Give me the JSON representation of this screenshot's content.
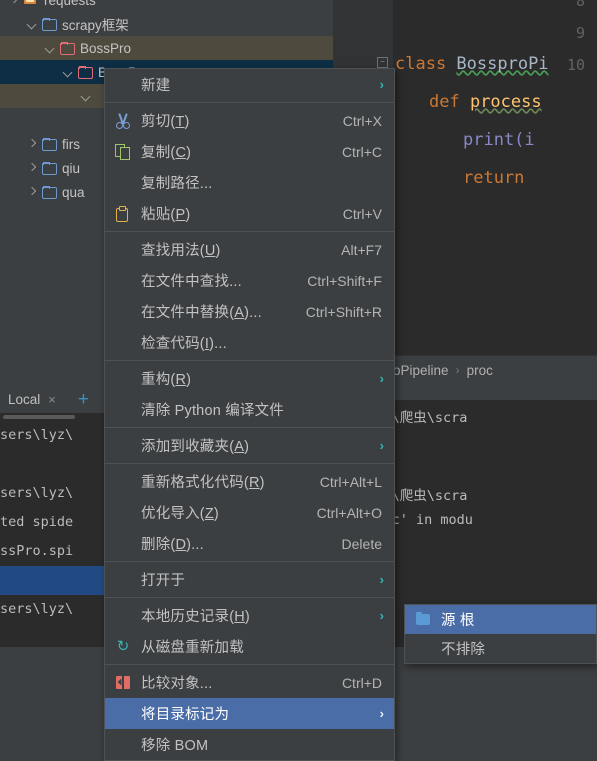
{
  "project_tree": {
    "rows": [
      {
        "label": "requests",
        "icon": "library-icon",
        "chevron": "right",
        "indent": 8,
        "state": "normal"
      },
      {
        "label": "scrapy框架",
        "icon": "folder-blue-icon",
        "chevron": "down",
        "indent": 26,
        "state": "normal"
      },
      {
        "label": "BossPro",
        "icon": "folder-pink-icon",
        "chevron": "down",
        "indent": 44,
        "state": "olive"
      },
      {
        "label": "BossPro",
        "icon": "folder-pink-icon",
        "chevron": "down",
        "indent": 62,
        "state": "selected"
      },
      {
        "label": "",
        "icon": "",
        "chevron": "down",
        "indent": 80,
        "state": "olive"
      },
      {
        "label": "firs",
        "icon": "folder-blue-icon",
        "chevron": "right",
        "indent": 26,
        "state": "normal"
      },
      {
        "label": "qiu",
        "icon": "folder-blue-icon",
        "chevron": "right",
        "indent": 26,
        "state": "normal"
      },
      {
        "label": "qua",
        "icon": "folder-blue-icon",
        "chevron": "right",
        "indent": 26,
        "state": "normal"
      }
    ]
  },
  "run_panel": {
    "tab_label": "Local",
    "close_label": "×",
    "add_label": "+",
    "console_lines": [
      {
        "text": "sers\\lyz\\",
        "selected": false
      },
      {
        "text": "",
        "selected": false
      },
      {
        "text": "sers\\lyz\\",
        "selected": false
      },
      {
        "text": "ted spide",
        "selected": false
      },
      {
        "text": "ssPro.spi",
        "selected": false
      },
      {
        "text": "",
        "selected": true
      },
      {
        "text": "sers\\lyz\\",
        "selected": false
      }
    ]
  },
  "editor": {
    "line_numbers": [
      "8",
      "9",
      "10"
    ],
    "code_lines": [
      {
        "indent": 0,
        "segments": [
          {
            "t": "class ",
            "c": "kw"
          },
          {
            "t": "BossproPi",
            "c": "cls squig"
          }
        ]
      },
      {
        "indent": 2,
        "segments": [
          {
            "t": "def ",
            "c": "kw"
          },
          {
            "t": "process",
            "c": "fn squig2"
          }
        ]
      },
      {
        "indent": 4,
        "segments": [
          {
            "t": "print(i",
            "c": "bi"
          }
        ]
      },
      {
        "indent": 4,
        "segments": [
          {
            "t": "return ",
            "c": "kw"
          }
        ]
      }
    ]
  },
  "breadcrumb": {
    "items": [
      "BossproPipeline",
      "proc"
    ],
    "separator": "›"
  },
  "right_console": {
    "lines": [
      {
        "text": "oject\\爬虫\\scra",
        "selected": false
      },
      {
        "text": "",
        "selected": false
      },
      {
        "text": "oject\\爬虫\\scra",
        "selected": false
      },
      {
        "text": "'basic' in modu",
        "selected": false
      }
    ]
  },
  "context_menu": {
    "groups": [
      {
        "items": [
          {
            "label": "新建",
            "icon": null,
            "accel": null,
            "arrow": true,
            "selected": false
          }
        ]
      },
      {
        "items": [
          {
            "label": "剪切(T)",
            "mnemonic": "T",
            "icon": "scissors-icon",
            "accel": "Ctrl+X",
            "arrow": false,
            "selected": false
          },
          {
            "label": "复制(C)",
            "mnemonic": "C",
            "icon": "copy-icon",
            "accel": "Ctrl+C",
            "arrow": false,
            "selected": false
          },
          {
            "label": "复制路径...",
            "icon": null,
            "accel": null,
            "arrow": false,
            "selected": false
          },
          {
            "label": "粘贴(P)",
            "mnemonic": "P",
            "icon": "clipboard-icon",
            "accel": "Ctrl+V",
            "arrow": false,
            "selected": false
          }
        ]
      },
      {
        "items": [
          {
            "label": "查找用法(U)",
            "mnemonic": "U",
            "icon": null,
            "accel": "Alt+F7",
            "arrow": false,
            "selected": false
          },
          {
            "label": "在文件中查找...",
            "icon": null,
            "accel": "Ctrl+Shift+F",
            "arrow": false,
            "selected": false
          },
          {
            "label": "在文件中替换(A)...",
            "mnemonic": "A",
            "icon": null,
            "accel": "Ctrl+Shift+R",
            "arrow": false,
            "selected": false
          },
          {
            "label": "检查代码(I)...",
            "mnemonic": "I",
            "icon": null,
            "accel": null,
            "arrow": false,
            "selected": false
          }
        ]
      },
      {
        "items": [
          {
            "label": "重构(R)",
            "mnemonic": "R",
            "icon": null,
            "accel": null,
            "arrow": true,
            "selected": false
          },
          {
            "label": "清除 Python 编译文件",
            "icon": null,
            "accel": null,
            "arrow": false,
            "selected": false
          }
        ]
      },
      {
        "items": [
          {
            "label": "添加到收藏夹(A)",
            "mnemonic": "A",
            "icon": null,
            "accel": null,
            "arrow": true,
            "selected": false
          }
        ]
      },
      {
        "items": [
          {
            "label": "重新格式化代码(R)",
            "mnemonic": "R",
            "icon": null,
            "accel": "Ctrl+Alt+L",
            "arrow": false,
            "selected": false
          },
          {
            "label": "优化导入(Z)",
            "mnemonic": "Z",
            "icon": null,
            "accel": "Ctrl+Alt+O",
            "arrow": false,
            "selected": false
          },
          {
            "label": "删除(D)...",
            "mnemonic": "D",
            "icon": null,
            "accel": "Delete",
            "arrow": false,
            "selected": false
          }
        ]
      },
      {
        "items": [
          {
            "label": "打开于",
            "icon": null,
            "accel": null,
            "arrow": true,
            "selected": false
          }
        ]
      },
      {
        "items": [
          {
            "label": "本地历史记录(H)",
            "mnemonic": "H",
            "icon": null,
            "accel": null,
            "arrow": true,
            "selected": false
          },
          {
            "label": "从磁盘重新加载",
            "icon": "refresh-icon",
            "accel": null,
            "arrow": false,
            "selected": false
          }
        ]
      },
      {
        "items": [
          {
            "label": "比较对象...",
            "icon": "compare-icon",
            "accel": "Ctrl+D",
            "arrow": false,
            "selected": false
          },
          {
            "label": "将目录标记为",
            "icon": null,
            "accel": null,
            "arrow": true,
            "selected": true
          },
          {
            "label": "移除 BOM",
            "icon": null,
            "accel": null,
            "arrow": false,
            "selected": false
          }
        ]
      }
    ]
  },
  "submenu": {
    "items": [
      {
        "label": "源 根",
        "icon": "folder-blue-solid-icon",
        "selected": true
      },
      {
        "label": "不排除",
        "icon": null,
        "selected": false
      }
    ]
  },
  "colors": {
    "menu_bg": "#3c3f41",
    "menu_border": "#4e5254",
    "highlight": "#4a6da7",
    "tree_selected": "#0d2e44",
    "tree_olive": "#4e4a3e",
    "editor_bg": "#2b2b2b",
    "accent_teal": "#2eb8b8",
    "console_selected": "#214a85"
  }
}
